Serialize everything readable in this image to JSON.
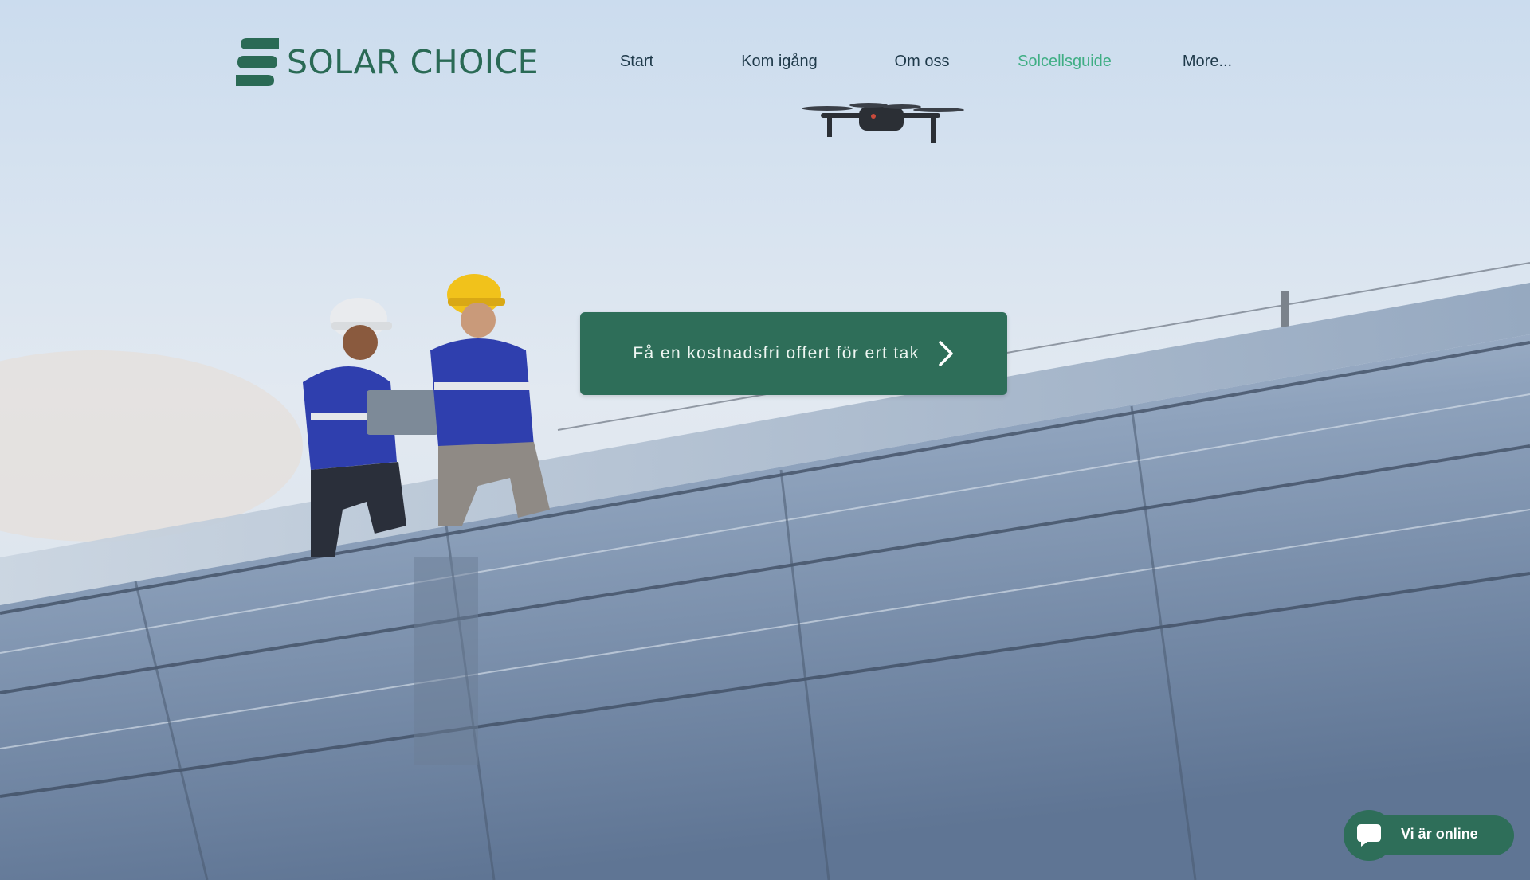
{
  "brand": {
    "name": "SOLAR CHOICE",
    "color": "#2a6a55"
  },
  "nav": {
    "items": [
      {
        "label": "Start",
        "active": false
      },
      {
        "label": "Kom igång",
        "active": false
      },
      {
        "label": "Om oss",
        "active": false
      },
      {
        "label": "Solcellsguide",
        "active": true
      },
      {
        "label": "More...",
        "active": false
      }
    ],
    "active_color": "#3fae84"
  },
  "hero": {
    "cta_label": "Få en kostnadsfri offert för ert tak",
    "cta_icon": "chevron-right-icon",
    "cta_color": "#2e6e59",
    "image": "photo-workers-on-solar-roof-with-drone"
  },
  "chat": {
    "label": "Vi är online",
    "icon": "chat-bubble-icon"
  }
}
